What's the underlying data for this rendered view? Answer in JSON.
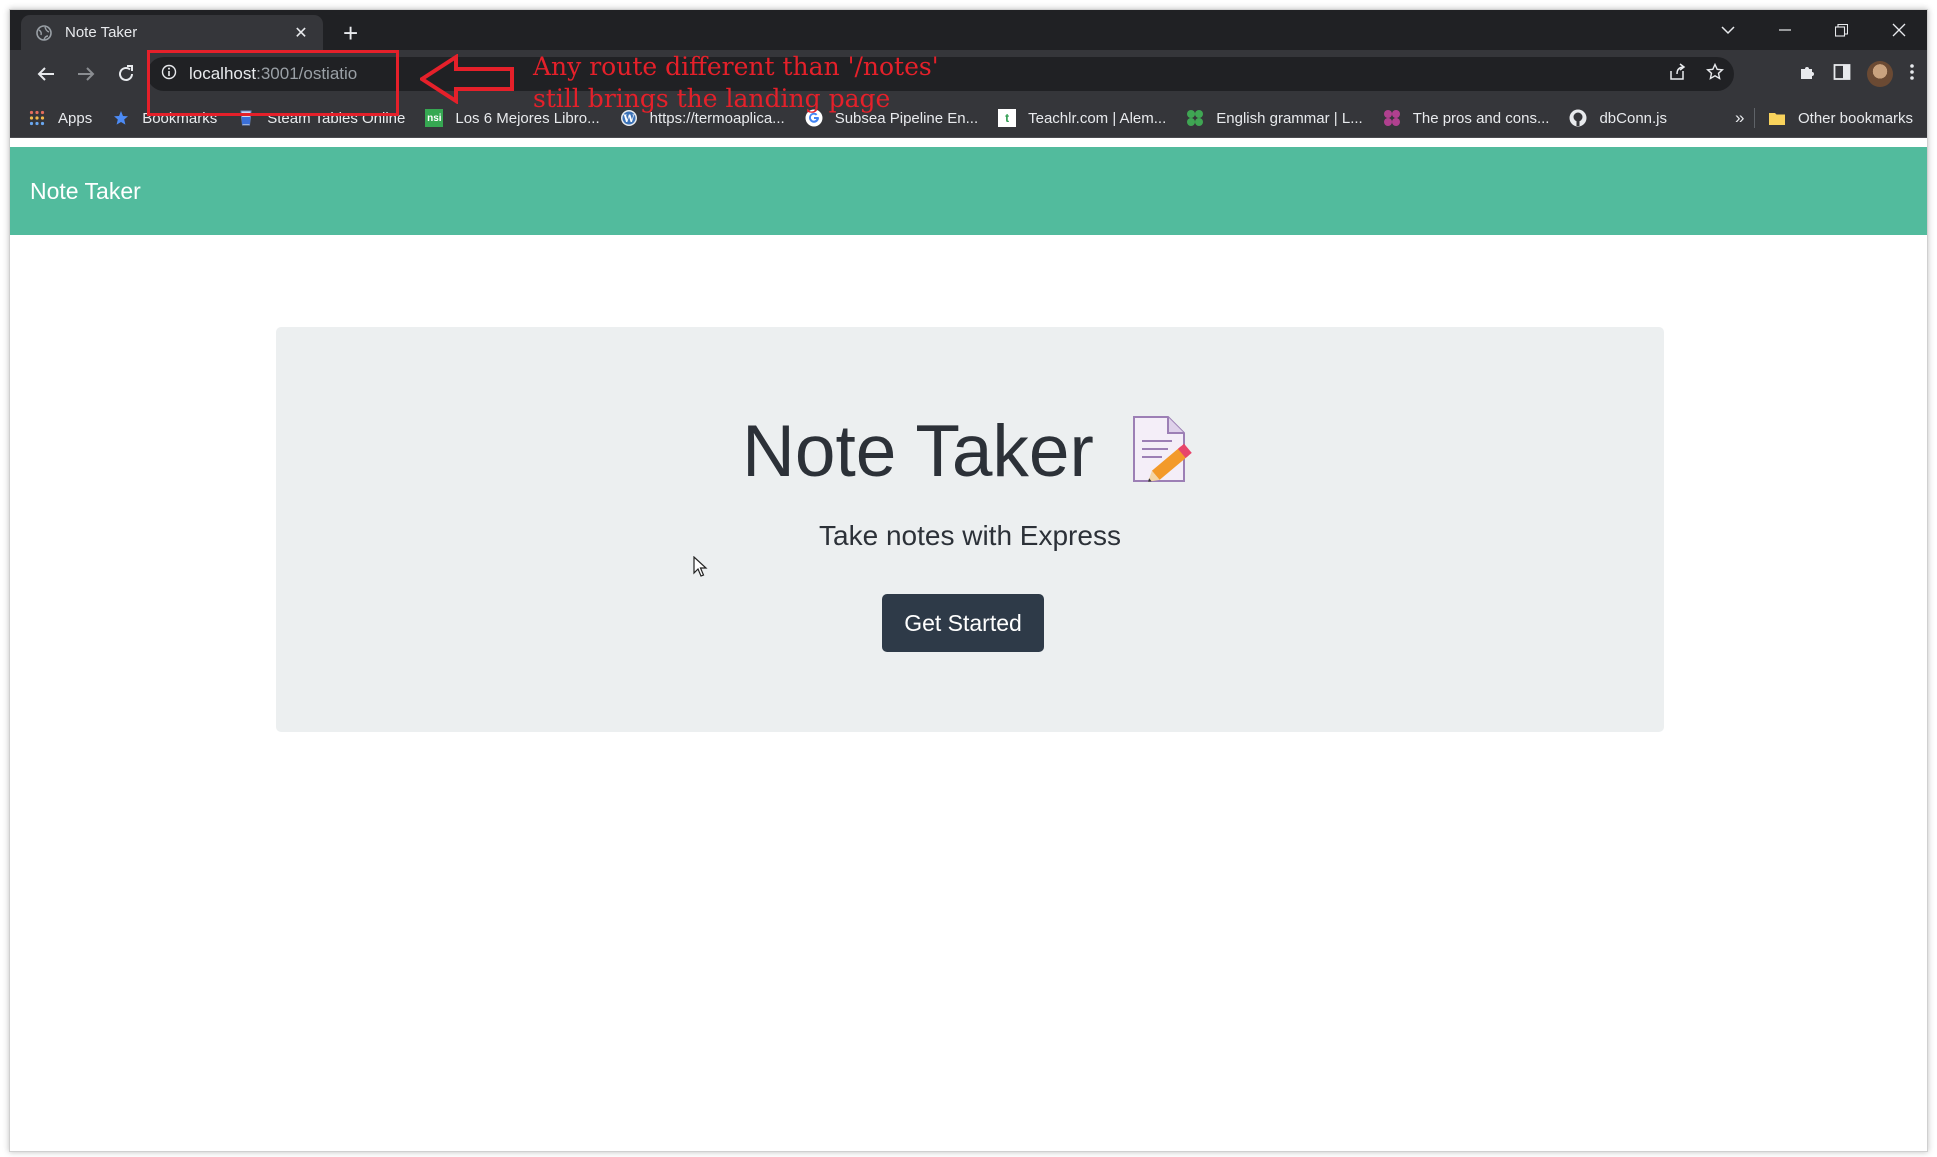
{
  "browser": {
    "tab_title": "Note Taker",
    "new_tab_label": "+",
    "url_host": "localhost",
    "url_path": ":3001/ostiatio",
    "bookmarks": [
      {
        "label": "Apps",
        "icon": "apps-grid-icon"
      },
      {
        "label": "Bookmarks",
        "icon": "star-icon"
      },
      {
        "label": "Steam Tables Online",
        "icon": "steam-tables-icon"
      },
      {
        "label": "Los 6 Mejores Libro...",
        "icon": "nsi-icon"
      },
      {
        "label": "https://termoaplica...",
        "icon": "wordpress-icon"
      },
      {
        "label": "Subsea Pipeline En...",
        "icon": "google-icon"
      },
      {
        "label": "Teachlr.com | Alem...",
        "icon": "teachlr-icon"
      },
      {
        "label": "English grammar | L...",
        "icon": "green-dots-icon"
      },
      {
        "label": "The pros and cons...",
        "icon": "purple-dots-icon"
      },
      {
        "label": "dbConn.js",
        "icon": "github-icon"
      }
    ],
    "more_bookmarks": "»",
    "other_bookmarks": "Other bookmarks"
  },
  "annotation": {
    "line1": "Any route different than '/notes'",
    "line2": "still brings the landing page",
    "color": "#e5202a"
  },
  "app": {
    "brand": "Note Taker",
    "hero_title": "Note Taker",
    "hero_subtitle": "Take notes with Express",
    "cta_label": "Get Started",
    "navbar_color": "#52bb9d",
    "button_color": "#2e3a48"
  }
}
